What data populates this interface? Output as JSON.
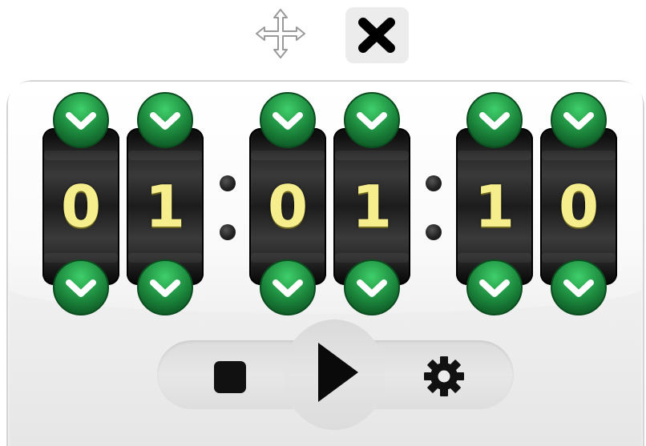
{
  "window": {
    "move_icon": "move-arrows-icon",
    "close_icon": "close-x-icon"
  },
  "timer": {
    "separator": ":",
    "digits": [
      {
        "group": "hours",
        "value": "0"
      },
      {
        "group": "hours",
        "value": "1"
      },
      {
        "group": "minutes",
        "value": "0"
      },
      {
        "group": "minutes",
        "value": "1"
      },
      {
        "group": "seconds",
        "value": "1"
      },
      {
        "group": "seconds",
        "value": "0"
      }
    ],
    "arrow_icon": "chevron-down-icon"
  },
  "controls": {
    "stop_icon": "stop-icon",
    "play_icon": "play-icon",
    "settings_icon": "gear-icon"
  },
  "colors": {
    "digit": "#f6ee8c",
    "drum": "#1c1c1c",
    "arrow_button": "#1d8a3e",
    "arrow_button_light": "#3fcf6a",
    "widget_bg": "#f4f4f4",
    "control_bar": "#e0e0e0"
  }
}
